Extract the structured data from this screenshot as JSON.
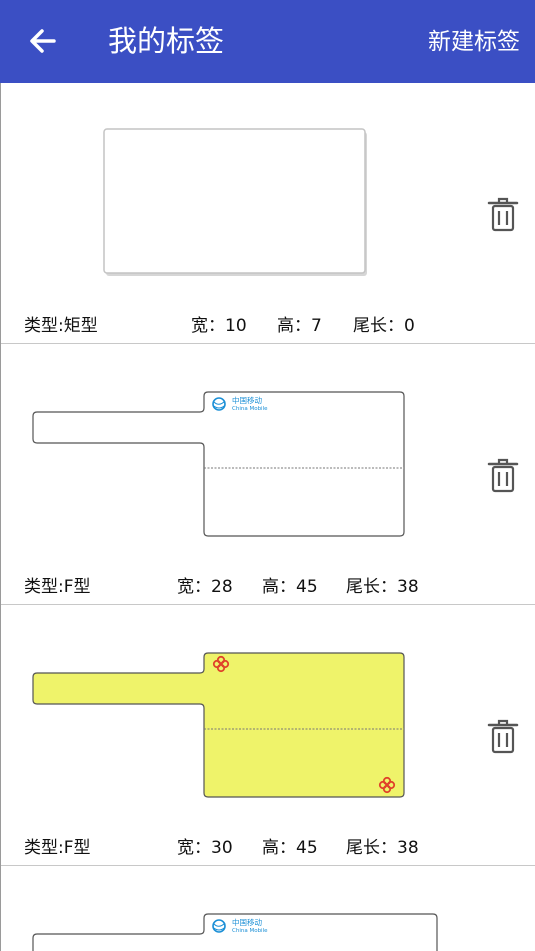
{
  "header": {
    "title": "我的标签",
    "new_label": "新建标签",
    "bar_color": "#3b4fc4"
  },
  "icons": {
    "back": "arrow-left-icon",
    "delete": "trash-icon",
    "logo": "china-mobile-logo",
    "knot": "chinese-knot-icon"
  },
  "colors": {
    "yellow_tag": "#eff36a"
  },
  "logo": {
    "cn": "中国移动",
    "en": "China Mobile"
  },
  "items": [
    {
      "type": "类型:矩型",
      "width": "宽：10",
      "height": "高：7",
      "tail": "尾长：0"
    },
    {
      "type": "类型:F型",
      "width": "宽：28",
      "height": "高：45",
      "tail": "尾长：38"
    },
    {
      "type": "类型:F型",
      "width": "宽：30",
      "height": "高：45",
      "tail": "尾长：38"
    }
  ]
}
